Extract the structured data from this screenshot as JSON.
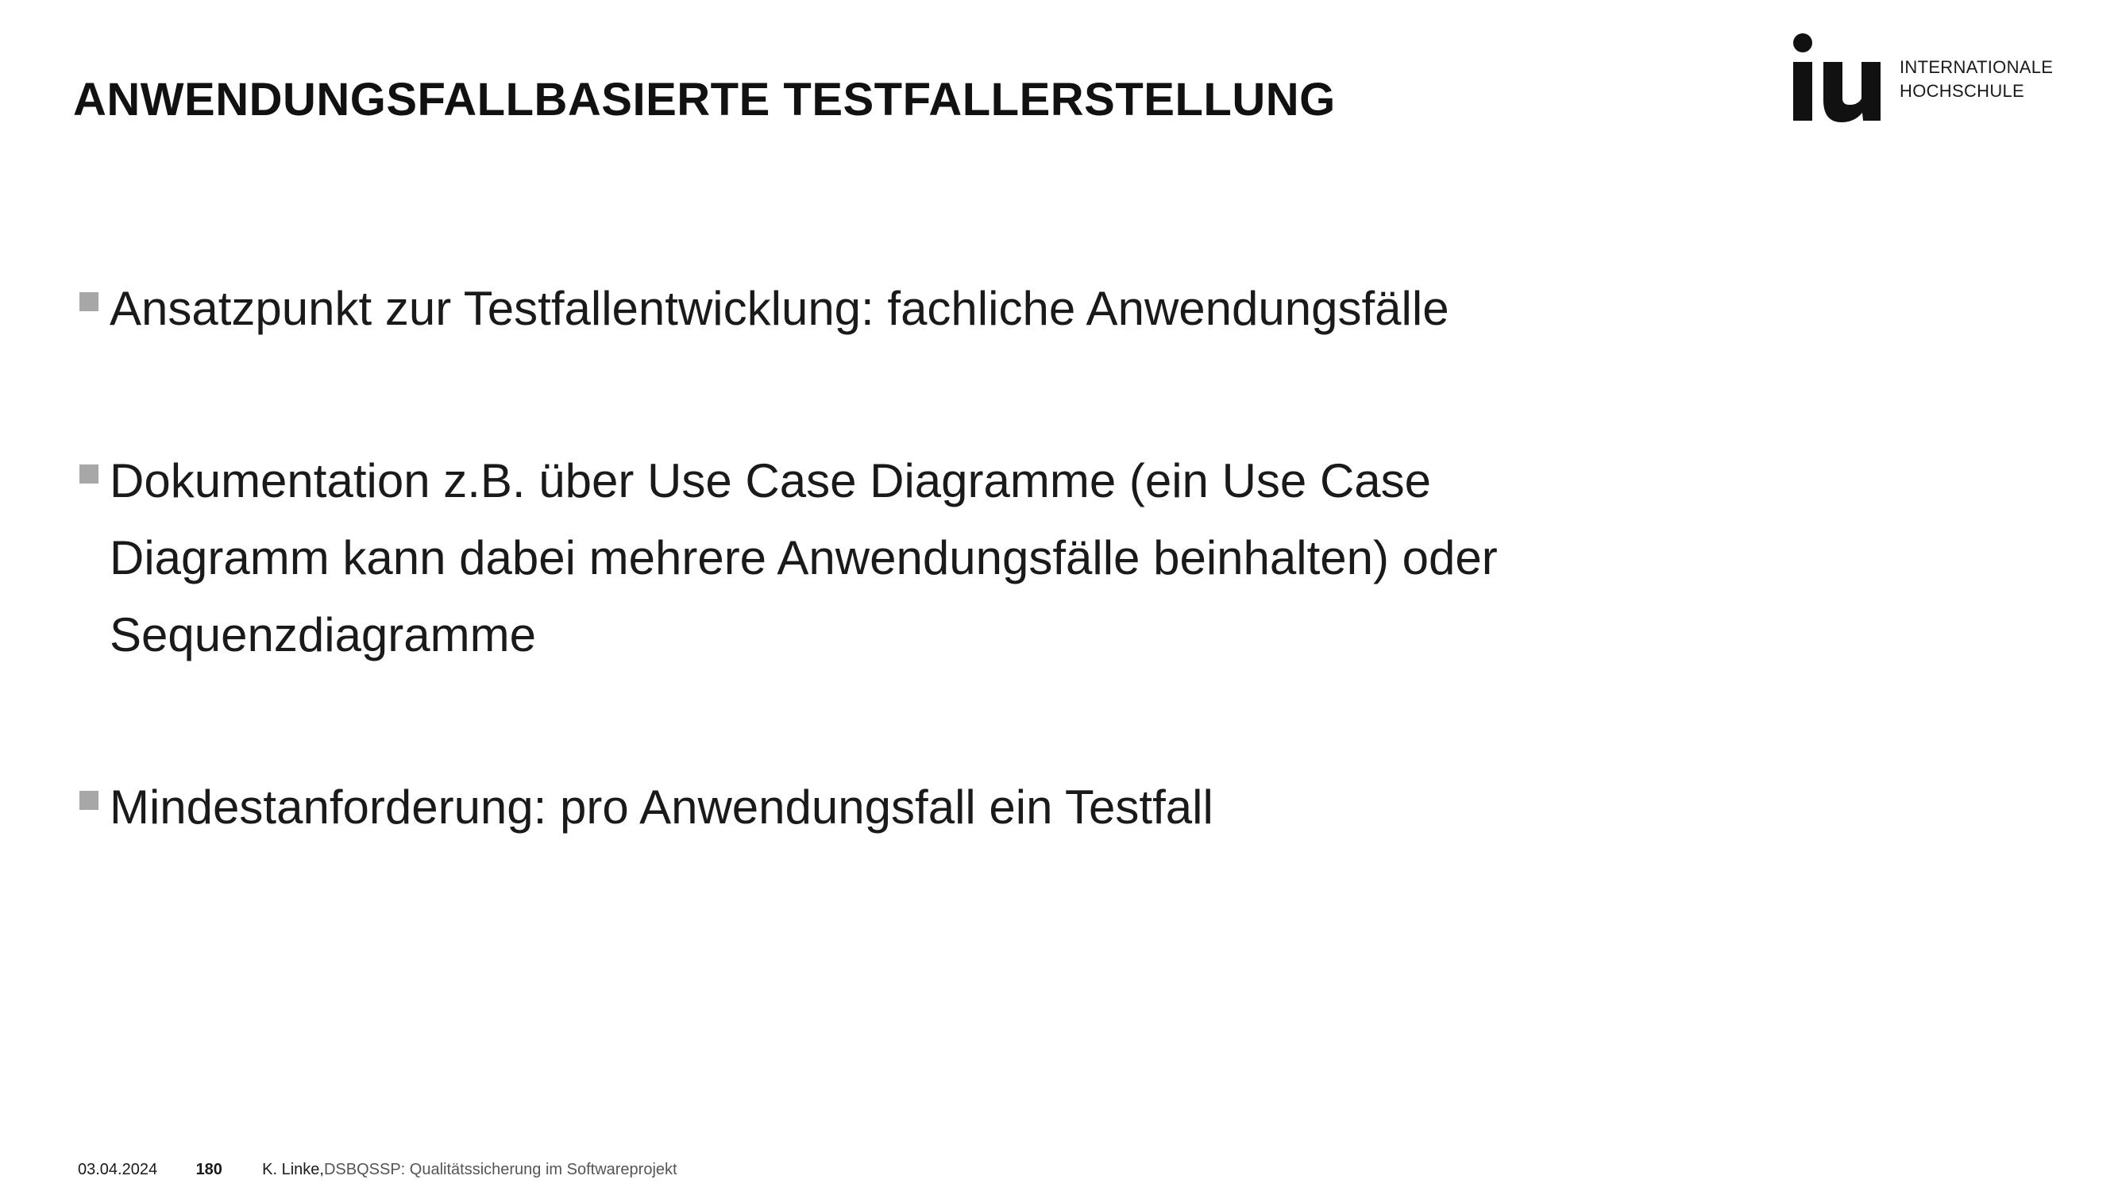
{
  "slide": {
    "title": "ANWENDUNGSFALLBASIERTE TESTFALLERSTELLUNG"
  },
  "logo": {
    "mark": "iu",
    "line1": "INTERNATIONALE",
    "line2": "HOCHSCHULE"
  },
  "bullets": [
    {
      "lines": [
        "Ansatzpunkt zur Testfallentwicklung: fachliche Anwendungsfälle"
      ]
    },
    {
      "lines": [
        "Dokumentation z.B. über Use Case Diagramme (ein Use Case",
        "Diagramm kann dabei mehrere Anwendungsfälle beinhalten) oder",
        "Sequenzdiagramme"
      ]
    },
    {
      "lines": [
        "Mindestanforderung: pro Anwendungsfall ein Testfall"
      ]
    }
  ],
  "footer": {
    "date": "03.04.2024",
    "page": "180",
    "author": "K. Linke, ",
    "course": "DSBQSSP: Qualitätssicherung im Softwareprojekt"
  },
  "colors": {
    "text": "#1a1a1a",
    "bullet_marker": "#a7a7a7",
    "background": "#ffffff"
  }
}
